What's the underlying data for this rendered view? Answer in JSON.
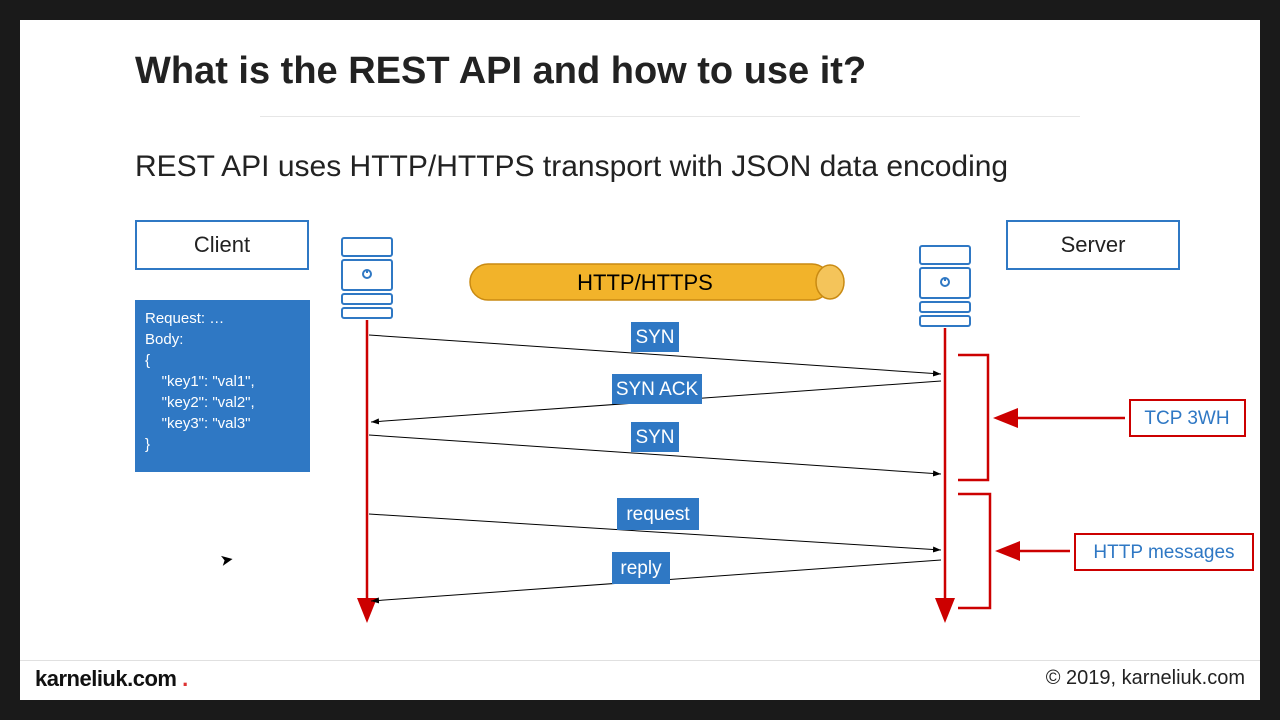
{
  "title": "What is the REST API and how to use it?",
  "subtitle": "REST API uses HTTP/HTTPS transport with JSON data encoding",
  "client_label": "Client",
  "server_label": "Server",
  "pipe_label": "HTTP/HTTPS",
  "json_box": "Request: …\nBody:\n{\n    \"key1\": \"val1\",\n    \"key2\": \"val2\",\n    \"key3\": \"val3\"\n}",
  "messages": {
    "syn1": "SYN",
    "synack": "SYN ACK",
    "syn2": "SYN",
    "request": "request",
    "reply": "reply"
  },
  "group1_label": "TCP 3WH",
  "group2_label": "HTTP messages",
  "brand": "karneliuk.com",
  "copyright": "© 2019, karneliuk.com"
}
